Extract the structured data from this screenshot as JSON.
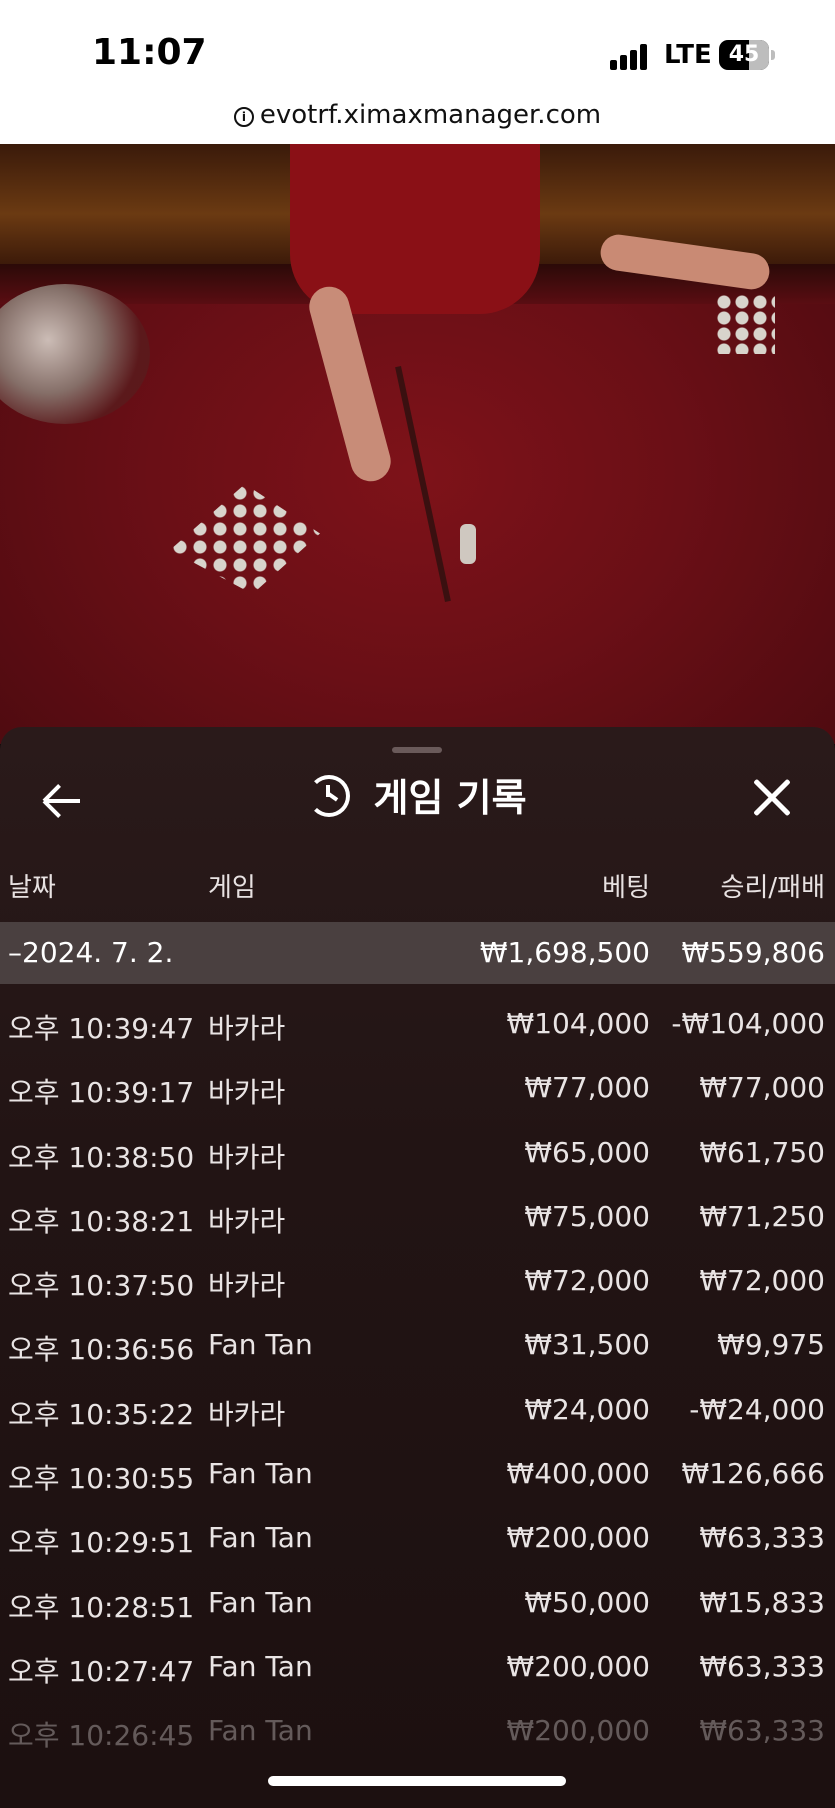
{
  "status_bar": {
    "time": "11:07",
    "network": "LTE",
    "battery": "45"
  },
  "browser": {
    "url": "evotrf.ximaxmanager.com"
  },
  "panel": {
    "title": "게임 기록",
    "columns": {
      "date": "날짜",
      "game": "게임",
      "bet": "베팅",
      "result": "승리/패배"
    },
    "summary": {
      "date": "–2024. 7. 2.",
      "bet": "₩1,698,500",
      "result": "₩559,806"
    },
    "rows": [
      {
        "time": "오후 10:39:47",
        "game": "바카라",
        "bet": "₩104,000",
        "result": "-₩104,000"
      },
      {
        "time": "오후 10:39:17",
        "game": "바카라",
        "bet": "₩77,000",
        "result": "₩77,000"
      },
      {
        "time": "오후 10:38:50",
        "game": "바카라",
        "bet": "₩65,000",
        "result": "₩61,750"
      },
      {
        "time": "오후 10:38:21",
        "game": "바카라",
        "bet": "₩75,000",
        "result": "₩71,250"
      },
      {
        "time": "오후 10:37:50",
        "game": "바카라",
        "bet": "₩72,000",
        "result": "₩72,000"
      },
      {
        "time": "오후 10:36:56",
        "game": "Fan Tan",
        "bet": "₩31,500",
        "result": "₩9,975"
      },
      {
        "time": "오후 10:35:22",
        "game": "바카라",
        "bet": "₩24,000",
        "result": "-₩24,000"
      },
      {
        "time": "오후 10:30:55",
        "game": "Fan Tan",
        "bet": "₩400,000",
        "result": "₩126,666"
      },
      {
        "time": "오후 10:29:51",
        "game": "Fan Tan",
        "bet": "₩200,000",
        "result": "₩63,333"
      },
      {
        "time": "오후 10:28:51",
        "game": "Fan Tan",
        "bet": "₩50,000",
        "result": "₩15,833"
      },
      {
        "time": "오후 10:27:47",
        "game": "Fan Tan",
        "bet": "₩200,000",
        "result": "₩63,333"
      },
      {
        "time": "오후 10:26:45",
        "game": "Fan Tan",
        "bet": "₩200,000",
        "result": "₩63,333"
      }
    ]
  }
}
